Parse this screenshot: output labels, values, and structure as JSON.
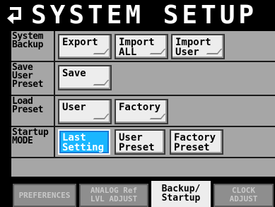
{
  "title": "SYSTEM SETUP",
  "back_icon": "return-arrow-icon",
  "rows": {
    "system_backup": {
      "label": "System Backup",
      "buttons": {
        "export": "Export",
        "import_all": "Import ALL",
        "import_user": "Import User"
      }
    },
    "save_user_preset": {
      "label": "Save User Preset",
      "buttons": {
        "save": "Save"
      }
    },
    "load_preset": {
      "label": "Load Preset",
      "buttons": {
        "user": "User",
        "factory": "Factory"
      }
    },
    "startup_mode": {
      "label": "Startup MODE",
      "buttons": {
        "last_setting": "Last Setting",
        "user_preset": "User Preset",
        "factory_preset": "Factory Preset"
      },
      "selected": "Last Setting"
    }
  },
  "tabs": {
    "preferences": "PREFERENCES",
    "analog_ref": "ANALOG Ref LVL ADJUST",
    "backup_startup": "Backup/ Startup",
    "clock_adjust": "CLOCK ADJUST"
  },
  "selected_tab": "Backup/ Startup",
  "colors": {
    "accent": "#19b6ff",
    "panel": "#a6a6a6",
    "button": "#ededed",
    "background": "#000000"
  }
}
